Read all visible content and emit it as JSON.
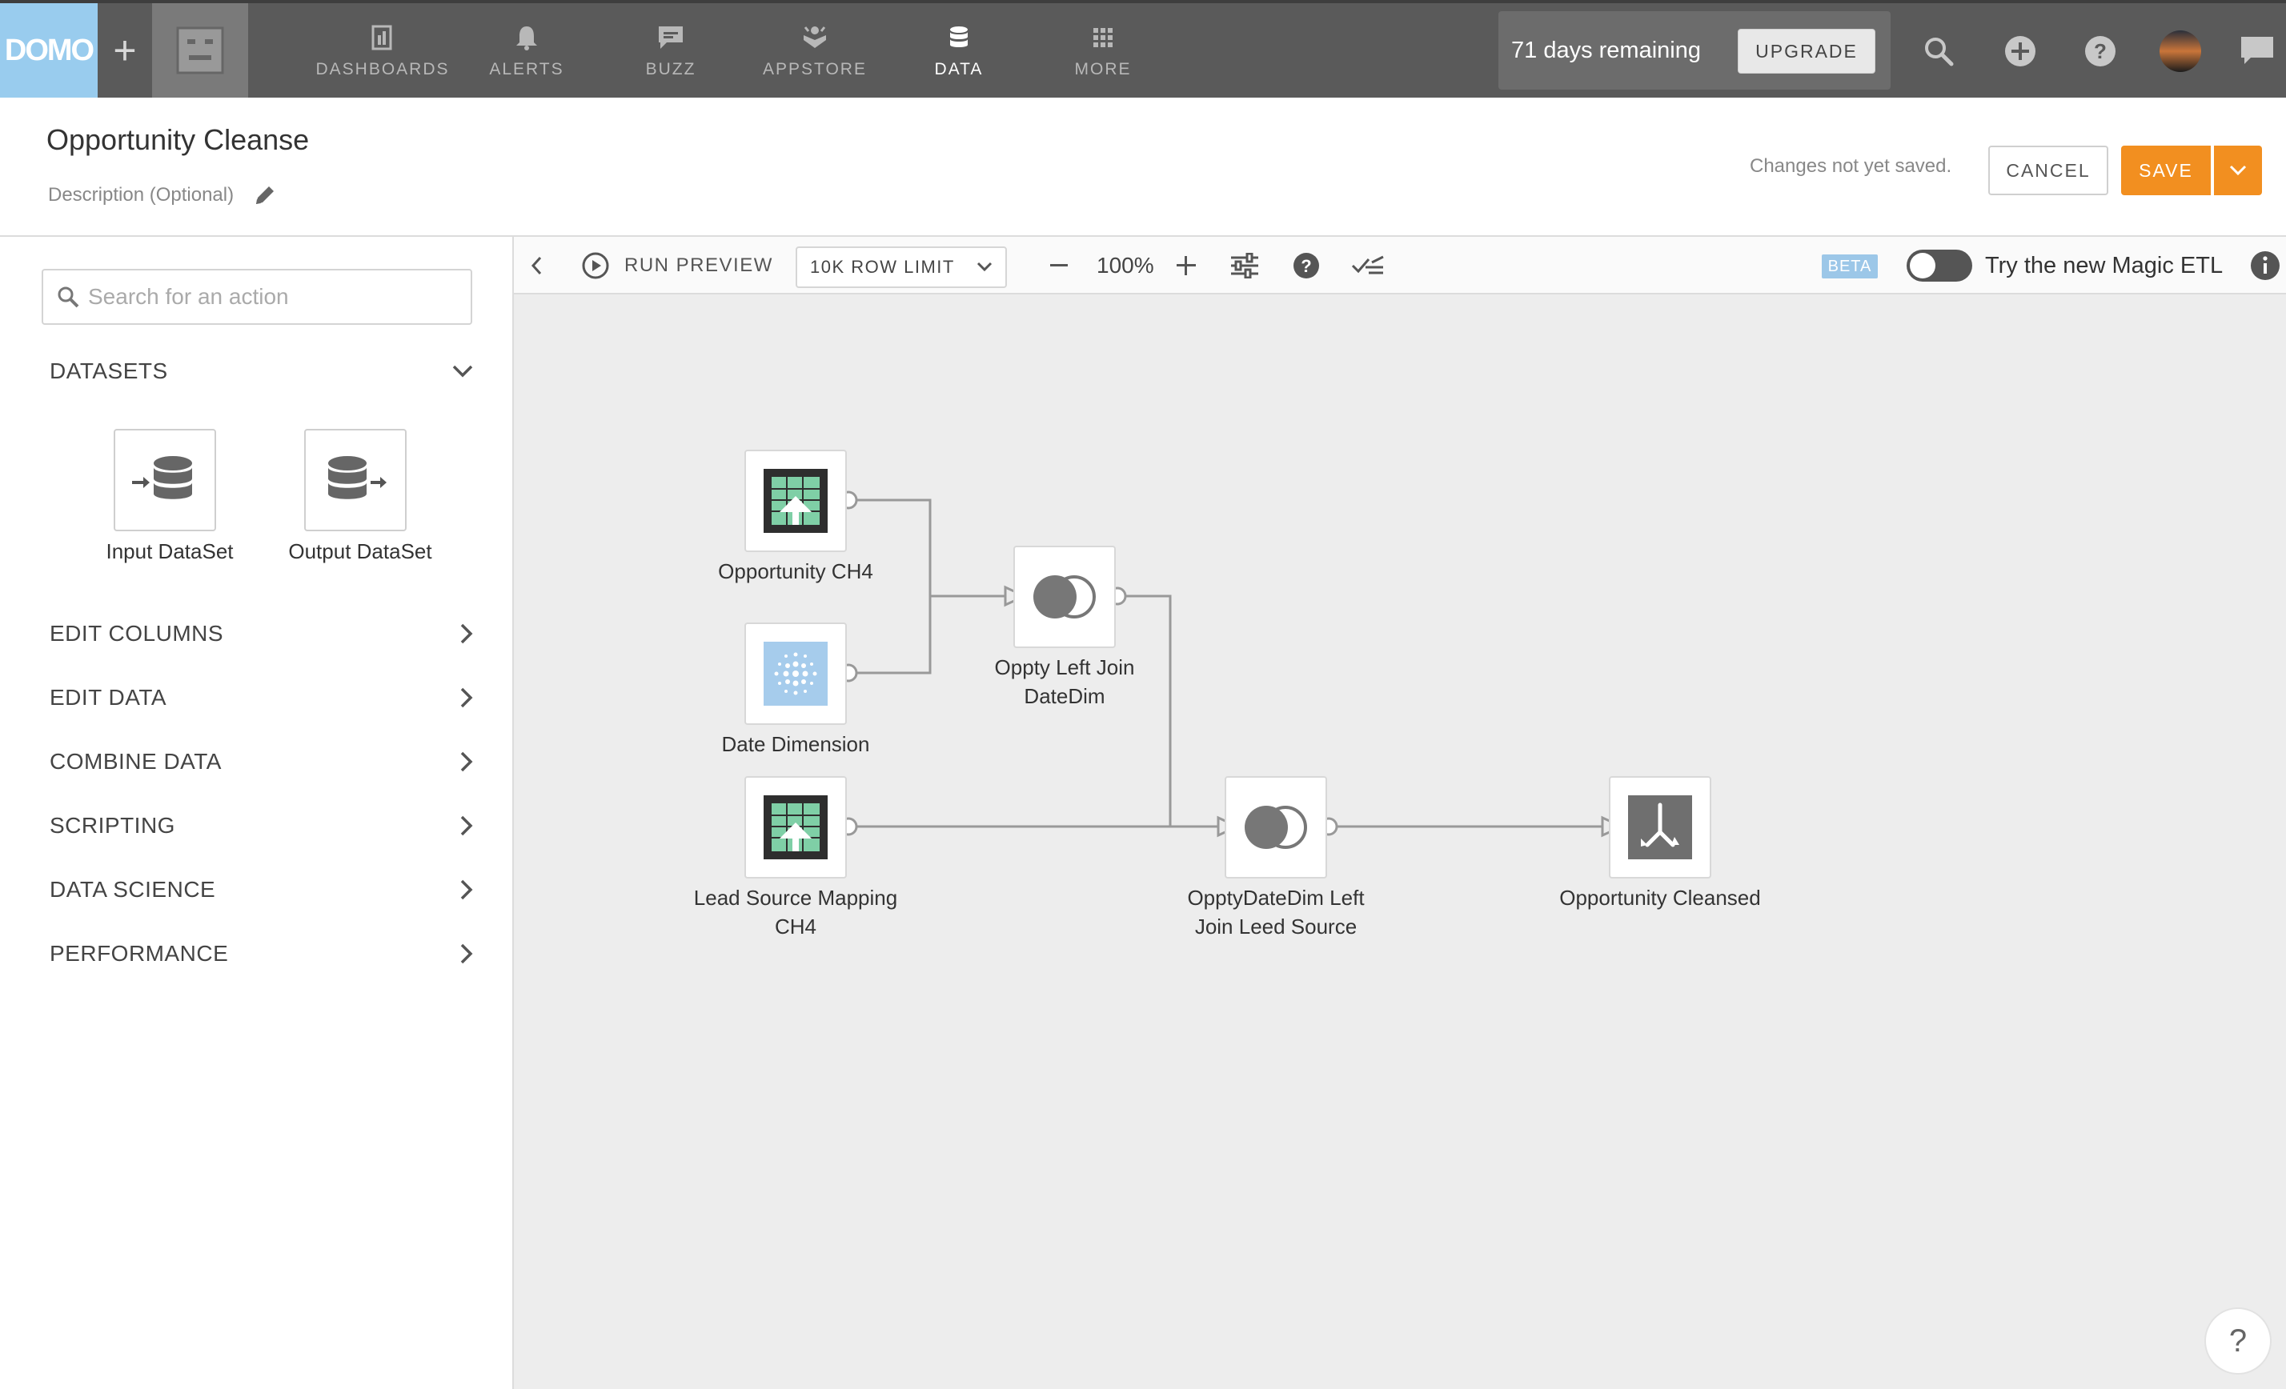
{
  "topnav": {
    "logo": "DOMO",
    "plus": "+",
    "items": [
      {
        "label": "DASHBOARDS",
        "icon": "dashboards-icon",
        "active": false
      },
      {
        "label": "ALERTS",
        "icon": "bell-icon",
        "active": false
      },
      {
        "label": "BUZZ",
        "icon": "chat-icon",
        "active": false
      },
      {
        "label": "APPSTORE",
        "icon": "appstore-icon",
        "active": false
      },
      {
        "label": "DATA",
        "icon": "database-icon",
        "active": true
      },
      {
        "label": "MORE",
        "icon": "grid-icon",
        "active": false
      }
    ],
    "trial_text": "71 days remaining",
    "upgrade_label": "UPGRADE"
  },
  "header": {
    "title": "Opportunity Cleanse",
    "description_placeholder": "Description (Optional)",
    "save_status": "Changes not yet saved.",
    "cancel_label": "CANCEL",
    "save_label": "SAVE"
  },
  "sidebar": {
    "search_placeholder": "Search for an action",
    "datasets_label": "DATASETS",
    "dataset_tiles": [
      {
        "label": "Input DataSet"
      },
      {
        "label": "Output DataSet"
      }
    ],
    "sections": [
      {
        "label": "EDIT COLUMNS"
      },
      {
        "label": "EDIT DATA"
      },
      {
        "label": "COMBINE DATA"
      },
      {
        "label": "SCRIPTING"
      },
      {
        "label": "DATA SCIENCE"
      },
      {
        "label": "PERFORMANCE"
      }
    ]
  },
  "toolbar": {
    "run_preview_label": "RUN PREVIEW",
    "row_limit": "10K ROW LIMIT",
    "zoom": "100%",
    "beta_label": "BETA",
    "try_label": "Try the new Magic ETL"
  },
  "canvas": {
    "nodes": [
      {
        "id": "opportunity-ch4",
        "label": "Opportunity CH4",
        "type": "input"
      },
      {
        "id": "date-dimension",
        "label": "Date Dimension",
        "type": "input"
      },
      {
        "id": "lead-source-mapping",
        "label": "Lead Source Mapping CH4",
        "type": "input"
      },
      {
        "id": "oppty-left-join",
        "label": "Oppty Left Join DateDim",
        "type": "join"
      },
      {
        "id": "opptydatedim-left-join",
        "label": "OpptyDateDim Left Join Leed Source",
        "type": "join"
      },
      {
        "id": "opportunity-cleansed",
        "label": "Opportunity Cleansed",
        "type": "output"
      }
    ],
    "colors": {
      "canvas_bg": "#ededed",
      "accent_orange": "#f28f20",
      "logo_blue": "#99ccee",
      "input_icon_dark": "#2e2e2e",
      "input_icon_green": "#7fcfa6",
      "date_icon_blue": "#a6ccec"
    }
  },
  "help_fab": "?"
}
